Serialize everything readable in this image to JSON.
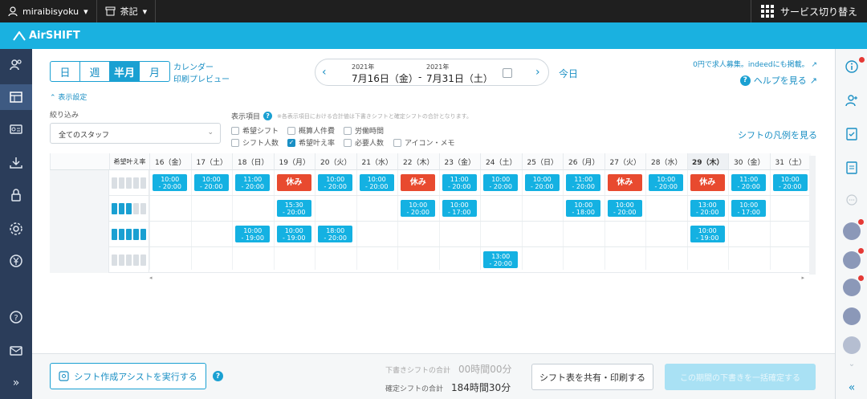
{
  "topbar": {
    "username": "miraibisyoku",
    "store": "茶記",
    "switch_label": "サービス切り替え"
  },
  "brand": {
    "name": "AirSHIFT"
  },
  "view_tabs": [
    {
      "label": "日",
      "selected": false
    },
    {
      "label": "週",
      "selected": false
    },
    {
      "label": "半月",
      "selected": true
    },
    {
      "label": "月",
      "selected": false
    }
  ],
  "links": {
    "calendar": "カレンダー",
    "print_preview": "印刷プレビュー"
  },
  "date_range": {
    "start_year": "2021年",
    "start_date": "7月16日（金）",
    "separator": "-",
    "end_year": "2021年",
    "end_date": "7月31日（土）"
  },
  "today_label": "今日",
  "right_links": {
    "recruit": "0円で求人募集。indeedにも掲載。",
    "help": "ヘルプを見る"
  },
  "display_settings": {
    "toggle": "表示設定",
    "filter_label": "絞り込み",
    "staff_select": "全てのスタッフ"
  },
  "display_items": {
    "label": "表示項目",
    "note": "※各表示項目における合計値は下書きシフトと確定シフトの合計となります。",
    "options": [
      {
        "label": "希望シフト",
        "checked": false
      },
      {
        "label": "概算人件費",
        "checked": false
      },
      {
        "label": "労働時間",
        "checked": false
      },
      {
        "label": "シフト人数",
        "checked": false
      },
      {
        "label": "希望叶え率",
        "checked": true
      },
      {
        "label": "必要人数",
        "checked": false
      },
      {
        "label": "アイコン・メモ",
        "checked": false
      }
    ]
  },
  "legend_link": "シフトの凡例を見る",
  "table": {
    "wish_header": "希望叶え率",
    "days": [
      "16（金）",
      "17（土）",
      "18（日）",
      "19（月）",
      "20（火）",
      "21（水）",
      "22（木）",
      "23（金）",
      "24（土）",
      "25（日）",
      "26（月）",
      "27（火）",
      "28（水）",
      "29（木）",
      "30（金）",
      "31（土）"
    ],
    "today_index": 13,
    "rows": [
      {
        "wish_level": 0,
        "cells": [
          {
            "d": 0,
            "t": "10:00\n- 20:00"
          },
          {
            "d": 1,
            "t": "10:00\n- 20:00"
          },
          {
            "d": 2,
            "t": "11:00\n- 20:00"
          },
          {
            "d": 3,
            "t": "休み",
            "off": true
          },
          {
            "d": 4,
            "t": "10:00\n- 20:00"
          },
          {
            "d": 5,
            "t": "10:00\n- 20:00"
          },
          {
            "d": 6,
            "t": "休み",
            "off": true
          },
          {
            "d": 7,
            "t": "11:00\n- 20:00"
          },
          {
            "d": 8,
            "t": "10:00\n- 20:00"
          },
          {
            "d": 9,
            "t": "10:00\n- 20:00"
          },
          {
            "d": 10,
            "t": "11:00\n- 20:00"
          },
          {
            "d": 11,
            "t": "休み",
            "off": true
          },
          {
            "d": 12,
            "t": "10:00\n- 20:00"
          },
          {
            "d": 13,
            "t": "休み",
            "off": true
          },
          {
            "d": 14,
            "t": "11:00\n- 20:00"
          },
          {
            "d": 15,
            "t": "10:00\n- 20:00"
          }
        ]
      },
      {
        "wish_level": 3,
        "cells": [
          {
            "d": 3,
            "t": "15:30\n- 20:00"
          },
          {
            "d": 6,
            "t": "10:00\n- 20:00"
          },
          {
            "d": 7,
            "t": "10:00\n- 17:00"
          },
          {
            "d": 10,
            "t": "10:00\n- 18:00"
          },
          {
            "d": 11,
            "t": "10:00\n- 20:00"
          },
          {
            "d": 13,
            "t": "13:00\n- 20:00"
          },
          {
            "d": 14,
            "t": "10:00\n- 17:00"
          }
        ]
      },
      {
        "wish_level": 5,
        "cells": [
          {
            "d": 2,
            "t": "10:00\n- 19:00"
          },
          {
            "d": 3,
            "t": "10:00\n- 19:00"
          },
          {
            "d": 4,
            "t": "18:00\n- 20:00"
          },
          {
            "d": 13,
            "t": "10:00\n- 19:00"
          }
        ]
      },
      {
        "wish_level": 0,
        "cells": [
          {
            "d": 8,
            "t": "13:00\n- 20:00"
          }
        ]
      }
    ]
  },
  "bottom": {
    "assist_button": "シフト作成アシストを実行する",
    "draft_label": "下書きシフトの合計",
    "draft_value": "00時間00分",
    "confirmed_label": "確定シフトの合計",
    "confirmed_value": "184時間30分",
    "share_button": "シフト表を共有・印刷する",
    "confirm_button": "この期間の下書きを一括確定する"
  },
  "colors": {
    "accent": "#1aa0d2",
    "shift": "#14b1e2",
    "off": "#e84a2f",
    "nav": "#2b3d5a"
  }
}
